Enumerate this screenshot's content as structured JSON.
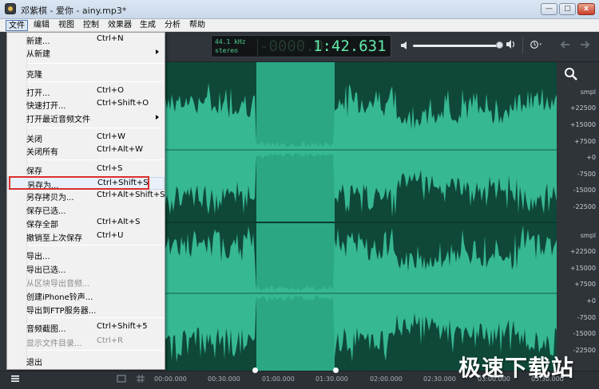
{
  "window": {
    "title": "邓紫棋 - 爱你 - ainy.mp3*",
    "controls": {
      "minimize": "—",
      "maximize": "□",
      "close": "x"
    }
  },
  "menubar": {
    "items": [
      "文件",
      "编辑",
      "视图",
      "控制",
      "效果器",
      "生成",
      "分析",
      "帮助"
    ],
    "active": "文件"
  },
  "file_menu": {
    "items": [
      {
        "label": "新建...",
        "shortcut": "Ctrl+N"
      },
      {
        "label": "从新建",
        "shortcut": "",
        "submenu": true
      },
      {
        "label": "克隆",
        "shortcut": ""
      },
      {
        "label": "打开...",
        "shortcut": "Ctrl+O"
      },
      {
        "label": "快速打开...",
        "shortcut": "Ctrl+Shift+O"
      },
      {
        "label": "打开最近音频文件",
        "shortcut": "",
        "submenu": true
      },
      {
        "label": "关闭",
        "shortcut": "Ctrl+W"
      },
      {
        "label": "关闭所有",
        "shortcut": "Ctrl+Alt+W"
      },
      {
        "label": "保存",
        "shortcut": "Ctrl+S"
      },
      {
        "label": "另存为...",
        "shortcut": "Ctrl+Shift+S",
        "highlighted": true
      },
      {
        "label": "另存拷贝为...",
        "shortcut": "Ctrl+Alt+Shift+S"
      },
      {
        "label": "保存已选...",
        "shortcut": ""
      },
      {
        "label": "保存全部",
        "shortcut": "Ctrl+Alt+S"
      },
      {
        "label": "撤销至上次保存",
        "shortcut": "Ctrl+U"
      },
      {
        "label": "导出...",
        "shortcut": ""
      },
      {
        "label": "导出已选...",
        "shortcut": ""
      },
      {
        "label": "从区块导出音频...",
        "shortcut": "",
        "disabled": true
      },
      {
        "label": "创建iPhone铃声...",
        "shortcut": ""
      },
      {
        "label": "导出到FTP服务器...",
        "shortcut": ""
      },
      {
        "label": "音频截图...",
        "shortcut": "Ctrl+Shift+5"
      },
      {
        "label": "显示文件目录...",
        "shortcut": "Ctrl+R",
        "disabled": true
      },
      {
        "label": "退出",
        "shortcut": ""
      }
    ]
  },
  "display": {
    "sample_rate": "44.1 kHz",
    "channels": "stereo",
    "ghost_digits": "-0000.0",
    "time": "1:42.631"
  },
  "volume": {
    "level": 0.96
  },
  "scale": {
    "top_channel": [
      "smpl",
      "+22500",
      "+15000",
      "+7500",
      "+0",
      "-7500",
      "-15000",
      "-22500"
    ],
    "bottom_channel": [
      "smpl",
      "+22500",
      "+15000",
      "+7500",
      "+0",
      "-7500",
      "-15000",
      "-22500"
    ]
  },
  "timeline": {
    "labels": [
      "00:00.000",
      "00:30.000",
      "01:00.000",
      "01:30.000",
      "02:00.000",
      "02:30.000",
      "03:00.000",
      "03:30.000"
    ]
  },
  "watermark": "极速下载站",
  "colors": {
    "waveform": "#36b893",
    "waveform_dark": "#14604b",
    "selection": "#2ba883",
    "highlight_box": "#d9302b",
    "time_digits": "#63ecab"
  }
}
